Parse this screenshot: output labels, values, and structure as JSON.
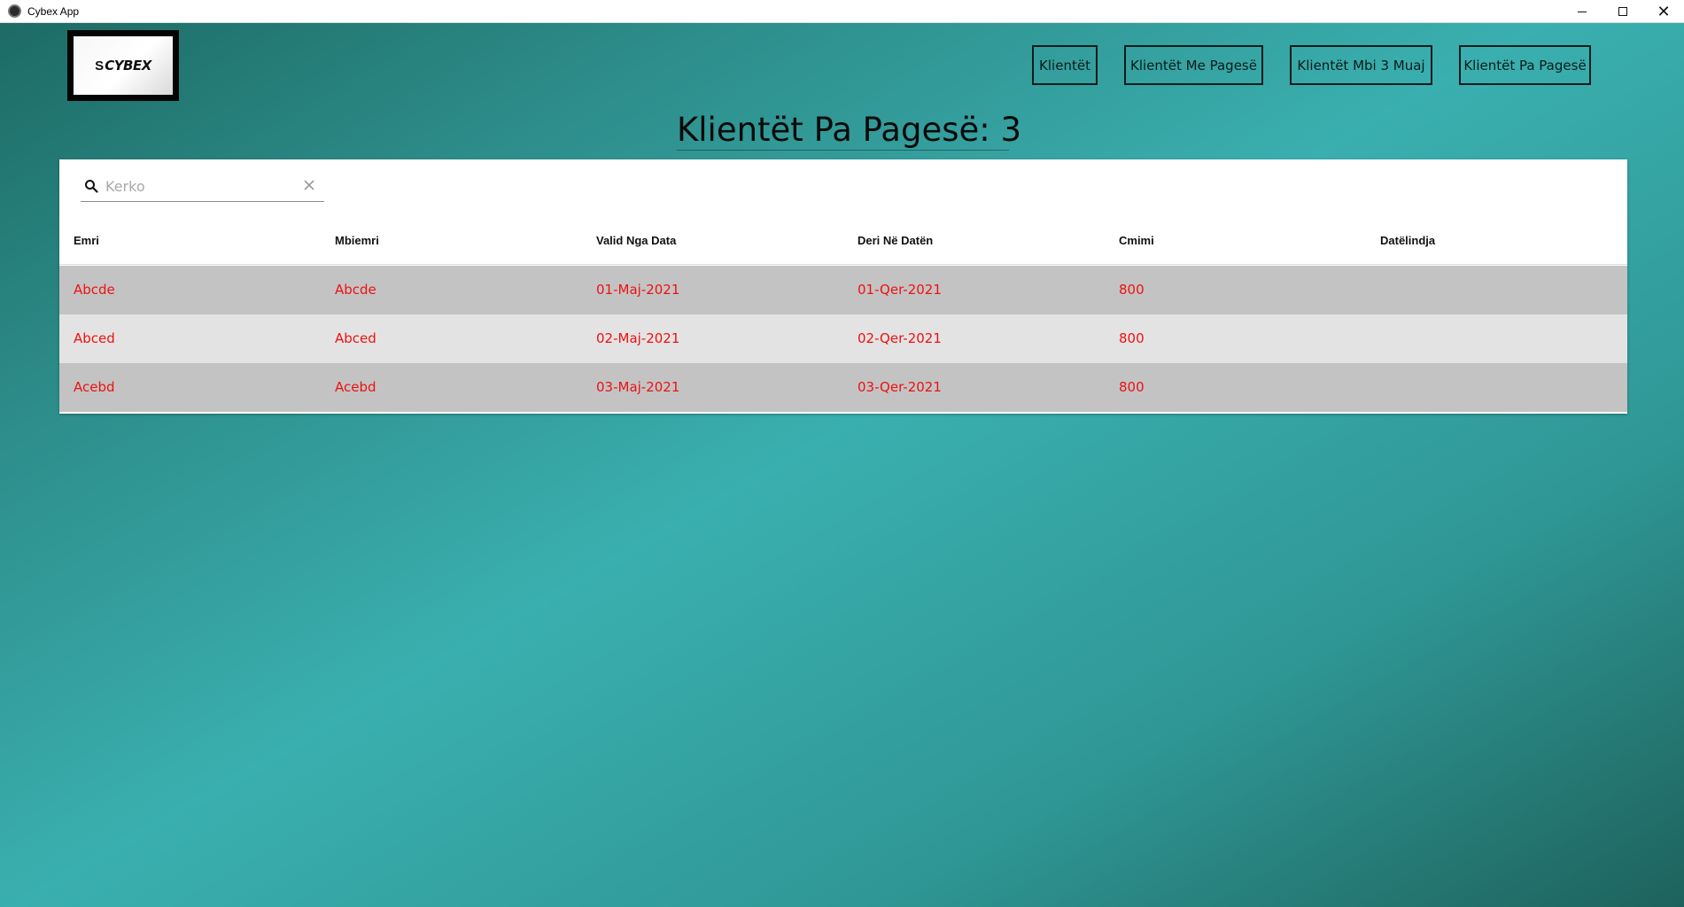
{
  "window": {
    "title": "Cybex App",
    "controls": {
      "minimize": "minimize-icon",
      "maximize": "maximize-icon",
      "close": "close-icon"
    }
  },
  "logo": {
    "text": "CYBEX",
    "swoosh": "S"
  },
  "nav": {
    "items": [
      {
        "label": "Klientët"
      },
      {
        "label": "Klientët Me Pagesë"
      },
      {
        "label": "Klientët Mbi 3 Muaj"
      },
      {
        "label": "Klientët Pa Pagesë"
      }
    ]
  },
  "page": {
    "title": "Klientët Pa Pagesë: 3"
  },
  "search": {
    "placeholder": "Kerko",
    "value": ""
  },
  "table": {
    "columns": [
      "Emri",
      "Mbiemri",
      "Valid Nga Data",
      "Deri Në Datën",
      "Cmimi",
      "Datëlindja"
    ],
    "rows": [
      [
        "Abcde",
        "Abcde",
        "01-Maj-2021",
        "01-Qer-2021",
        "800",
        ""
      ],
      [
        "Abced",
        "Abced",
        "02-Maj-2021",
        "02-Qer-2021",
        "800",
        ""
      ],
      [
        "Acebd",
        "Acebd",
        "03-Maj-2021",
        "03-Qer-2021",
        "800",
        ""
      ]
    ]
  },
  "colors": {
    "row_dark": "#c3c3c3",
    "row_light": "#e3e3e3",
    "text_red": "#ee1111",
    "accent_teal": "#3aafaf"
  }
}
